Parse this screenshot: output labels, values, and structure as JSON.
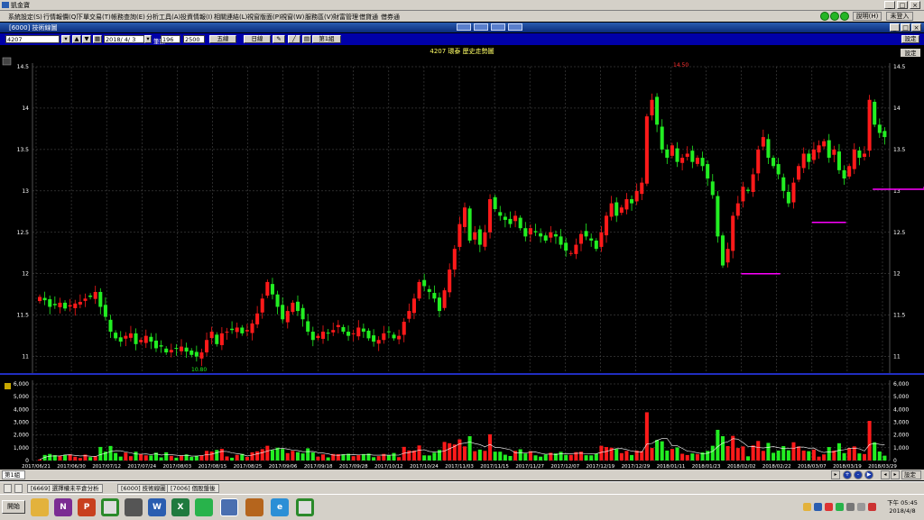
{
  "app": {
    "title": "凱金寶"
  },
  "menu": {
    "items": [
      "系統設定(S)",
      "行情報價(Q)",
      "下單交易(T)",
      "帳務查詢(E)",
      "分析工具(A)",
      "投資情報(I)",
      "相關連結(L)",
      "視窗版面(P)",
      "視窗(W)",
      "服務區(V)",
      "財富管理",
      "借貸通",
      "借券通"
    ],
    "help": "說明(H)",
    "login": "未登入"
  },
  "window": {
    "title": "[6000] 技術線圖",
    "settings": "設定"
  },
  "toolbar": {
    "symbol": "4207",
    "date": "2018/ 4/ 3",
    "count_label": "筆數",
    "count": "196",
    "total": "2500",
    "period": "五線",
    "frequency": "日線",
    "group": "第1組"
  },
  "chart": {
    "title": "4207 環泰 歷史走勢圖",
    "settings": "設定",
    "max_label": "14.50",
    "min_label": "10.80"
  },
  "bottom": {
    "group": "第1組",
    "settings": "設定"
  },
  "tabs": [
    "[6669] 選擇權未平倉分析",
    "[6000] 技術線圖",
    "[7006] 個股盤後"
  ],
  "clock": {
    "time": "下午 05:45",
    "date": "2018/4/8"
  },
  "taskbar": {
    "start": "開始"
  },
  "chart_data": {
    "type": "candlestick",
    "title": "4207 環泰 歷史走勢圖",
    "price_ylim": [
      10.8,
      14.5
    ],
    "price_ticks": [
      11,
      11.5,
      12,
      12.5,
      13,
      13.5,
      14,
      14.5
    ],
    "volume_ylim": [
      0,
      6000
    ],
    "volume_ticks": [
      "0",
      "1,000",
      "2,000",
      "3,000",
      "4,000",
      "5,000",
      "6,000"
    ],
    "date_labels": [
      "2017/06/21",
      "2017/06/30",
      "2017/07/12",
      "2017/07/24",
      "2017/08/03",
      "2017/08/15",
      "2017/08/25",
      "2017/09/06",
      "2017/09/18",
      "2017/09/28",
      "2017/10/12",
      "2017/10/24",
      "2017/11/03",
      "2017/11/15",
      "2017/11/27",
      "2017/12/07",
      "2017/12/19",
      "2017/12/29",
      "2018/01/11",
      "2018/01/23",
      "2018/02/02",
      "2018/02/22",
      "2018/03/07",
      "2018/03/19",
      "2018/03/29"
    ],
    "grid": true,
    "colors": {
      "up": "#ff1a1a",
      "down": "#22ee22",
      "background": "#000000",
      "grid": "#555555",
      "axis_text": "#ffffff",
      "support": "#ff00ff",
      "volume_ma": "#ffffff"
    },
    "support_lines": [
      {
        "price": 12.0,
        "from": 139,
        "to": 146
      },
      {
        "price": 12.62,
        "from": 153,
        "to": 159
      },
      {
        "price": 13.02,
        "from": 165,
        "to": 175
      },
      {
        "price": 13.04,
        "from": 175,
        "to": 180
      }
    ],
    "closes": [
      11.72,
      11.68,
      11.6,
      11.62,
      11.65,
      11.58,
      11.62,
      11.64,
      11.66,
      11.7,
      11.72,
      11.78,
      11.6,
      11.48,
      11.3,
      11.22,
      11.18,
      11.25,
      11.28,
      11.15,
      11.2,
      11.25,
      11.18,
      11.1,
      11.12,
      11.05,
      11.08,
      11.1,
      11.12,
      11.06,
      11.02,
      11.0,
      11.05,
      11.2,
      11.3,
      11.15,
      11.28,
      11.3,
      11.32,
      11.35,
      11.28,
      11.32,
      11.4,
      11.52,
      11.7,
      11.9,
      11.75,
      11.6,
      11.45,
      11.55,
      11.65,
      11.55,
      11.45,
      11.3,
      11.2,
      11.25,
      11.3,
      11.28,
      11.32,
      11.38,
      11.3,
      11.25,
      11.28,
      11.35,
      11.3,
      11.22,
      11.18,
      11.2,
      11.28,
      11.3,
      11.22,
      11.25,
      11.42,
      11.55,
      11.7,
      11.9,
      11.85,
      11.78,
      11.7,
      11.55,
      11.8,
      12.05,
      12.3,
      12.6,
      12.8,
      12.4,
      12.5,
      12.35,
      12.5,
      12.9,
      12.78,
      12.7,
      12.65,
      12.6,
      12.7,
      12.55,
      12.45,
      12.55,
      12.5,
      12.45,
      12.4,
      12.5,
      12.45,
      12.35,
      12.28,
      12.25,
      12.35,
      12.48,
      12.45,
      12.4,
      12.3,
      12.5,
      12.7,
      12.85,
      12.7,
      12.8,
      12.9,
      12.85,
      13.0,
      13.1,
      13.9,
      14.1,
      13.8,
      13.5,
      13.4,
      13.55,
      13.35,
      13.4,
      13.45,
      13.35,
      13.4,
      13.3,
      13.15,
      12.95,
      12.45,
      12.1,
      12.3,
      12.7,
      12.85,
      13.05,
      13.0,
      13.2,
      13.5,
      13.65,
      13.4,
      13.3,
      13.2,
      13.0,
      12.85,
      13.1,
      13.3,
      13.45,
      13.35,
      13.5,
      13.55,
      13.6,
      13.4,
      13.5,
      13.25,
      13.15,
      13.3,
      13.5,
      13.4,
      13.45,
      14.1,
      13.8,
      13.7,
      13.65
    ]
  }
}
